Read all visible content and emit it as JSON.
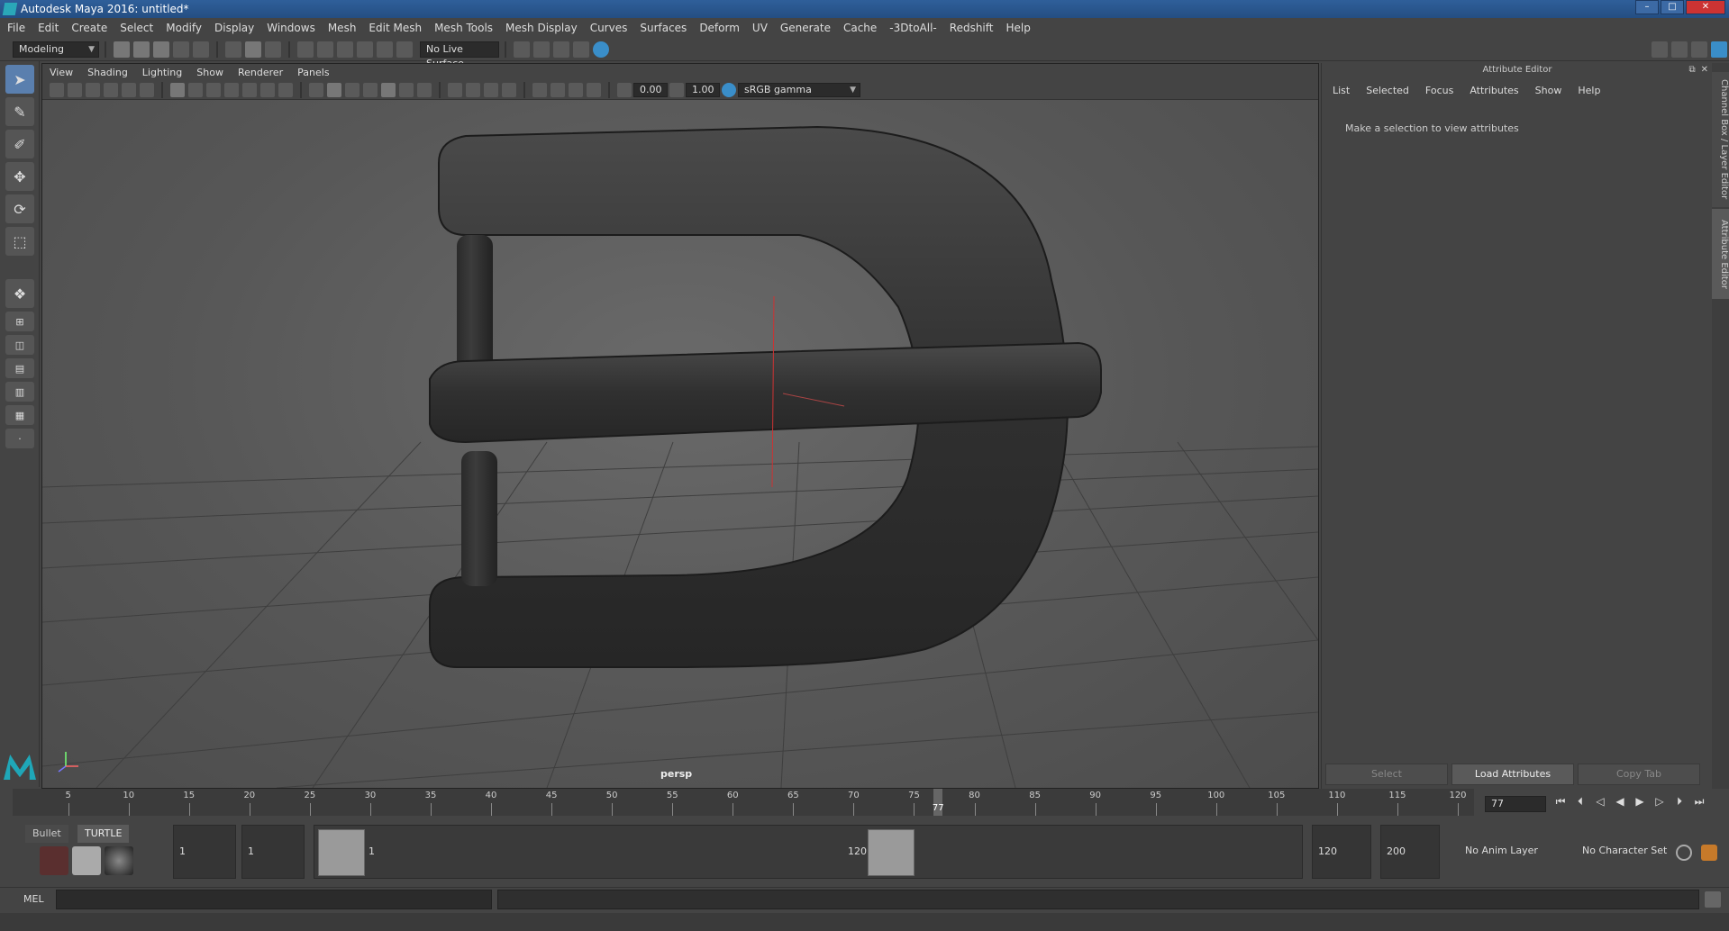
{
  "window": {
    "title": "Autodesk Maya 2016: untitled*"
  },
  "menu": [
    "File",
    "Edit",
    "Create",
    "Select",
    "Modify",
    "Display",
    "Windows",
    "Mesh",
    "Edit Mesh",
    "Mesh Tools",
    "Mesh Display",
    "Curves",
    "Surfaces",
    "Deform",
    "UV",
    "Generate",
    "Cache",
    "-3DtoAll-",
    "Redshift",
    "Help"
  ],
  "status": {
    "mode": "Modeling",
    "live_surface": "No Live Surface"
  },
  "viewport": {
    "menu": [
      "View",
      "Shading",
      "Lighting",
      "Show",
      "Renderer",
      "Panels"
    ],
    "exposure": "0.00",
    "gamma": "1.00",
    "color_space": "sRGB gamma",
    "camera_label": "persp"
  },
  "attribute_editor": {
    "title": "Attribute Editor",
    "menu": [
      "List",
      "Selected",
      "Focus",
      "Attributes",
      "Show",
      "Help"
    ],
    "message": "Make a selection to view attributes",
    "buttons": [
      "Select",
      "Load Attributes",
      "Copy Tab"
    ]
  },
  "side_tabs": [
    "Channel Box / Layer Editor",
    "Attribute Editor"
  ],
  "timeline": {
    "ticks": [
      5,
      10,
      15,
      20,
      25,
      30,
      35,
      40,
      45,
      50,
      55,
      60,
      65,
      70,
      75,
      80,
      85,
      90,
      95,
      100,
      105,
      110,
      115,
      120
    ],
    "start": 1,
    "end": 120,
    "current_frame": "77"
  },
  "shelf": {
    "tabs": [
      "Bullet",
      "TURTLE"
    ]
  },
  "range": {
    "start_time": "1",
    "playback_start": "1",
    "slider_start": "1",
    "slider_end": "120",
    "playback_end": "120",
    "end_time": "200",
    "anim_layer": "No Anim Layer",
    "character_set": "No Character Set"
  },
  "command": {
    "lang": "MEL"
  }
}
